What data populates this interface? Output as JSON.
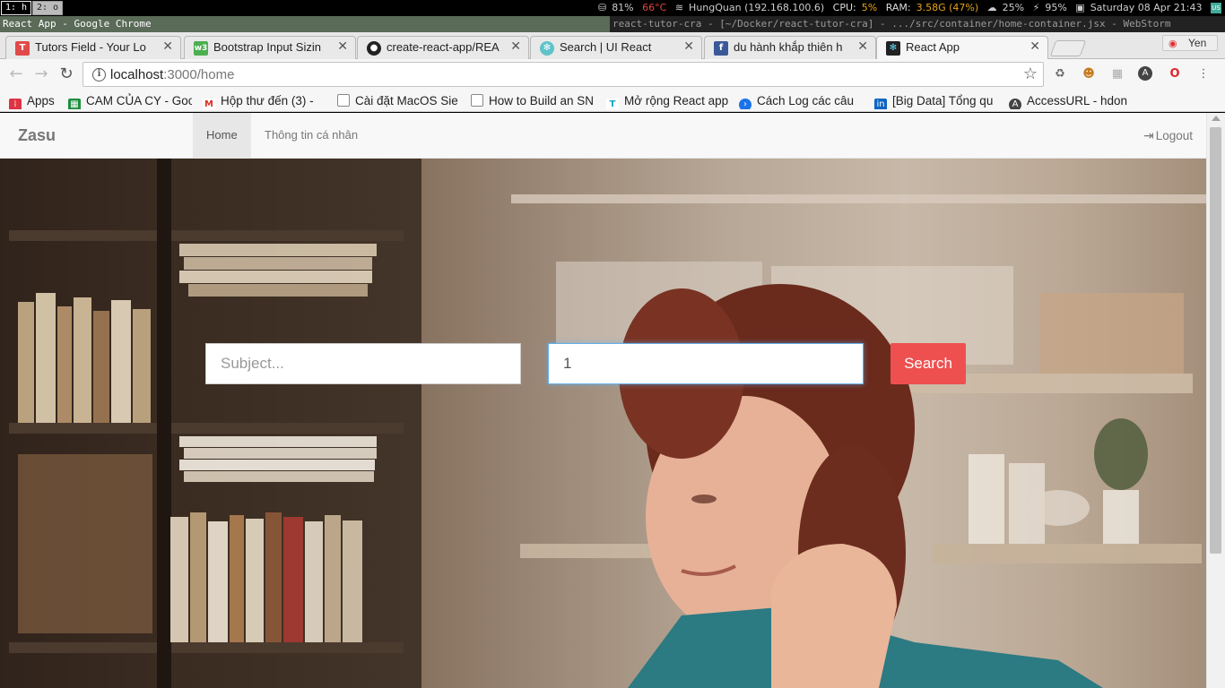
{
  "i3bar": {
    "workspaces": [
      "1: h",
      "2: o"
    ],
    "status": {
      "disk": "81%",
      "temp": "66°C",
      "wifi": "HungQuan (192.168.100.6)",
      "cpu_label": "CPU:",
      "cpu_value": "5%",
      "ram_label": "RAM:",
      "ram_value": "3.58G (47%)",
      "weather": "25%",
      "battery": "95%",
      "datetime": "Saturday 08 Apr 21:43",
      "layout": "US"
    }
  },
  "window_titles": {
    "left": "React App - Google Chrome",
    "right": "react-tutor-cra - [~/Docker/react-tutor-cra] - .../src/container/home-container.jsx - WebStorm"
  },
  "tabs": [
    {
      "title": "Tutors Field - Your Lo",
      "icon": "tutors-field-icon",
      "color": "#e04a4a",
      "glyph": "T"
    },
    {
      "title": "Bootstrap Input Sizin",
      "icon": "w3schools-icon",
      "color": "#4caf50",
      "glyph": "w3"
    },
    {
      "title": "create-react-app/REA",
      "icon": "github-icon",
      "color": "#222222",
      "glyph": "●"
    },
    {
      "title": "Search | UI React",
      "icon": "react-icon",
      "color": "#5fc3c8",
      "glyph": "✻"
    },
    {
      "title": "du hành khắp thiên h",
      "icon": "facebook-icon",
      "color": "#3b5998",
      "glyph": "f"
    },
    {
      "title": "React App",
      "icon": "react-icon",
      "color": "#222222",
      "glyph": "✻"
    }
  ],
  "profile": {
    "name": "Yen"
  },
  "omnibox": {
    "host": "localhost",
    "rest": ":3000/home"
  },
  "bookmarks": [
    {
      "label": "Apps",
      "icon": "apps-icon",
      "color": "#d34"
    },
    {
      "label": "CAM CỦA CY - Goo",
      "icon": "sheets-icon",
      "color": "#1e8e3e"
    },
    {
      "label": "Hộp thư đến (3) - ",
      "icon": "gmail-icon",
      "color": "#d93025"
    },
    {
      "label": "Cài đặt MacOS Sie",
      "icon": "page-icon",
      "color": "#888"
    },
    {
      "label": "How to Build an SN",
      "icon": "page-icon",
      "color": "#888"
    },
    {
      "label": "Mở rộng React app",
      "icon": "bookmark-icon",
      "color": "#19a0c8"
    },
    {
      "label": "Cách Log các câu",
      "icon": "terminal-icon",
      "color": "#1a73e8"
    },
    {
      "label": "[Big Data] Tổng qu",
      "icon": "linkedin-icon",
      "color": "#0a66c2"
    },
    {
      "label": "AccessURL - hdon",
      "icon": "accessurl-icon",
      "color": "#444"
    }
  ],
  "app": {
    "brand": "Zasu",
    "nav": [
      "Home",
      "Thông tin cá nhân"
    ],
    "logout": "Logout",
    "search": {
      "subject_placeholder": "Subject...",
      "level_value": "1",
      "button": "Search"
    }
  },
  "colors": {
    "accent": "#ee5050",
    "focus": "#66afe9"
  }
}
